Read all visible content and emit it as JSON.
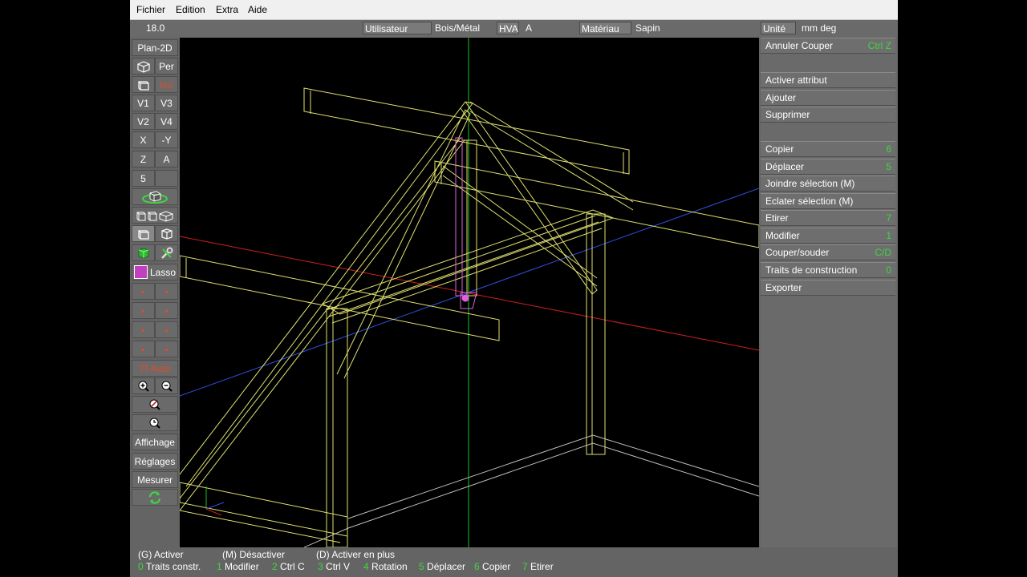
{
  "menu": [
    "Fichier",
    "Edition",
    "Extra",
    "Aide"
  ],
  "topbar": {
    "value": "18.0",
    "user_label": "Utilisateur",
    "material_type": "Bois/Métal",
    "hva_label": "HVA",
    "hva_value": "A",
    "material_label": "Matériau",
    "material_value": "Sapin",
    "unit_label": "Unité",
    "unit_value": "mm  deg"
  },
  "left_toolbar": {
    "plan2d": "Plan-2D",
    "per": "Per",
    "iso": "Iso",
    "v1": "V1",
    "v3": "V3",
    "v2": "V2",
    "v4": "V4",
    "x": "X",
    "neg_y": "-Y",
    "z": "Z",
    "a": "A",
    "five": "5",
    "lasso": "Lasso",
    "tf_auto": "Tf-Auto",
    "affichage": "Affichage",
    "reglages": "Réglages",
    "mesurer": "Mesurer"
  },
  "right_panel": {
    "annuler": "Annuler Couper",
    "annuler_sc": "Ctrl Z",
    "activer_attribut": "Activer attribut",
    "ajouter": "Ajouter",
    "supprimer": "Supprimer",
    "copier": "Copier",
    "copier_sc": "6",
    "deplacer": "Déplacer",
    "deplacer_sc": "5",
    "joindre": "Joindre sélection (M)",
    "eclater": "Eclater sélection (M)",
    "etirer": "Etirer",
    "etirer_sc": "7",
    "modifier": "Modifier",
    "modifier_sc": "1",
    "couper": "Couper/souder",
    "couper_sc": "C/D",
    "traits": "Traits de construction",
    "traits_sc": "0",
    "exporter": "Exporter"
  },
  "bottom": {
    "g_activer": "(G) Activer",
    "m_desactiver": "(M) Désactiver",
    "d_activer_plus": "(D) Activer en plus",
    "shortcuts": [
      {
        "key": "0",
        "label": "Traits constr."
      },
      {
        "key": "1",
        "label": "Modifier"
      },
      {
        "key": "2",
        "label": "Ctrl C"
      },
      {
        "key": "3",
        "label": "Ctrl V"
      },
      {
        "key": "4",
        "label": "Rotation"
      },
      {
        "key": "5",
        "label": "Déplacer"
      },
      {
        "key": "6",
        "label": "Copier"
      },
      {
        "key": "7",
        "label": "Etirer"
      }
    ]
  },
  "colors": {
    "wireframe": "#e0e070",
    "selected": "#e060e0",
    "axis_x": "#d02020",
    "axis_y": "#3050e0",
    "axis_z": "#20c020",
    "shortcut": "#3fd63f",
    "warning": "#e24b2b"
  }
}
